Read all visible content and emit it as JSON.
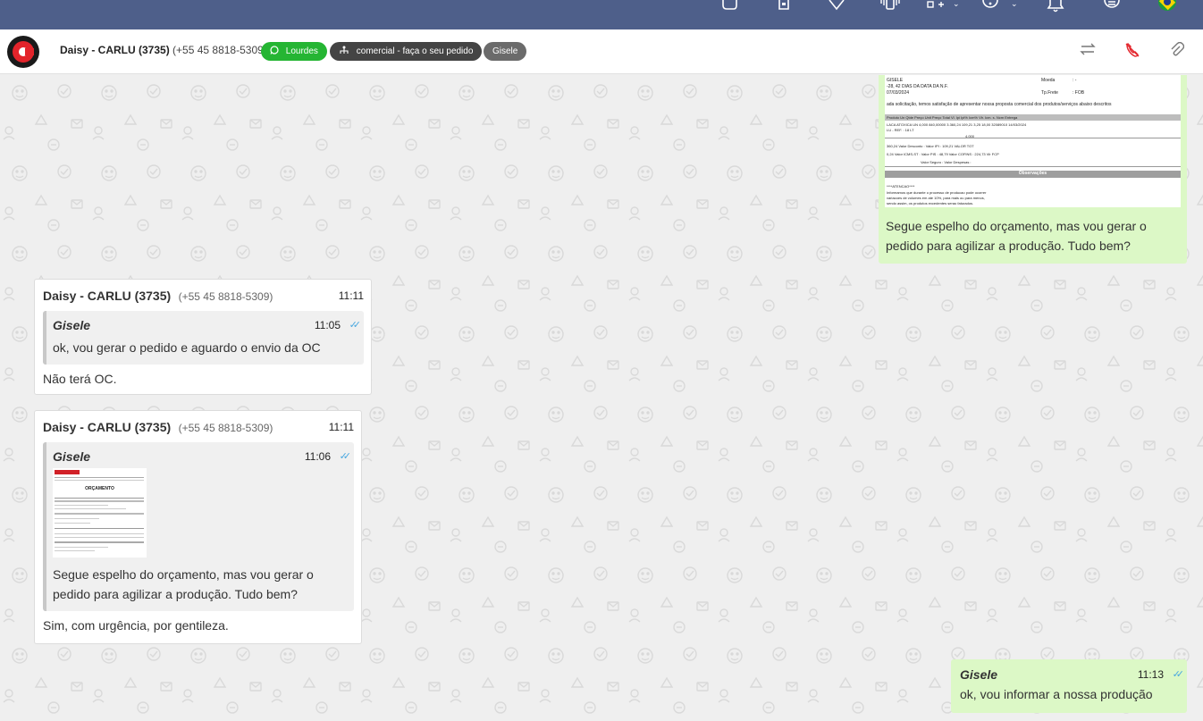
{
  "header": {
    "contact_name": "Daisy - CARLU (3735)",
    "contact_phone": "(+55 45 8818-5309)",
    "chips": {
      "agent": "Lourdes",
      "queue": "comercial - faça o seu pedido",
      "user": "Gisele"
    }
  },
  "icons": {
    "topbar": [
      "chat-bubbles-icon",
      "clipboard-icon",
      "check-heart-icon",
      "phone-vibrate-icon",
      "apps-add-icon",
      "help-icon",
      "bell-icon",
      "menu-circle-icon",
      "brazil-flag-icon"
    ],
    "header": [
      "transfer-icon",
      "end-call-icon",
      "paperclip-icon"
    ]
  },
  "colors": {
    "topbar": "#4e5f8a",
    "chip_green": "#25b533",
    "chip_dark": "#444444",
    "chip_gray": "#6b6b6b",
    "outgoing_bubble": "#dcf8c6",
    "read_tick": "#4aa8e0",
    "end_call": "#e3242b"
  },
  "top_out_message": {
    "text": "Segue espelho do orçamento, mas vou gerar o pedido para agilizar a produção. Tudo bem?",
    "doc": {
      "line1": "GISELE",
      "line2": "-28, 42 DIAS DA DATA DA N.F.",
      "line3": "07/03/2024",
      "moeda_label": "Moeda",
      "moeda_val": ": -",
      "frete_label": "Tp.Frete",
      "frete_val": ": FOB",
      "intro": "ada solicitação, temos satisfação de apresentar nossa proposta comercial dos produtos/serviços abaixo descritos",
      "cols": "Produto   Un   Qtde   Preço Unit   Preço Total   Vl. Ipi   Ipi%   Icm%   Vlr. Icm. s.   Ncm   Entrega",
      "row1": "LACA ATOXICA   UN   4,000   840,00000   3.360,24   109,21   3,25   18,00   32089010   14/03/2024",
      "row2": "LU - REF. : 18 LT",
      "row3": "4,000",
      "t1": "360,24   Valor Desconto   :   Valor IPI   :   109,21   VALOR TOT",
      "t2": "0,24   Valor ICMS-ST   :   Valor PIS   :   48,79   Valor COFINS   :   224,73   Vlr FCP",
      "t3": "Valor Seguro   :   Valor Despesas   :",
      "obs": "Observações",
      "atencao": "****ATENCAO****",
      "n1": "Informamos que durante o processo de producao pode ocorrer",
      "n2": "variacoes de volumes em ate 10%, para mais ou para menos,",
      "n3": "sendo assim, os produtos excedentes serao faturados."
    }
  },
  "messages": [
    {
      "sender": "Daisy - CARLU (3735)",
      "phone": "(+55 45 8818-5309)",
      "time": "11:11",
      "quote": {
        "name": "Gisele",
        "time": "11:05",
        "text": "ok, vou gerar o pedido e aguardo o envio da OC"
      },
      "text": "Não terá OC."
    },
    {
      "sender": "Daisy - CARLU (3735)",
      "phone": "(+55 45 8818-5309)",
      "time": "11:11",
      "quote": {
        "name": "Gisele",
        "time": "11:06",
        "thumb_title": "ORÇAMENTO",
        "text": "Segue espelho do orçamento, mas vou gerar o pedido para agilizar a produção. Tudo bem?"
      },
      "text": "Sim, com urgência, por gentileza."
    }
  ],
  "bottom_out_message": {
    "name": "Gisele",
    "time": "11:13",
    "text": "ok, vou informar a nossa produção"
  }
}
